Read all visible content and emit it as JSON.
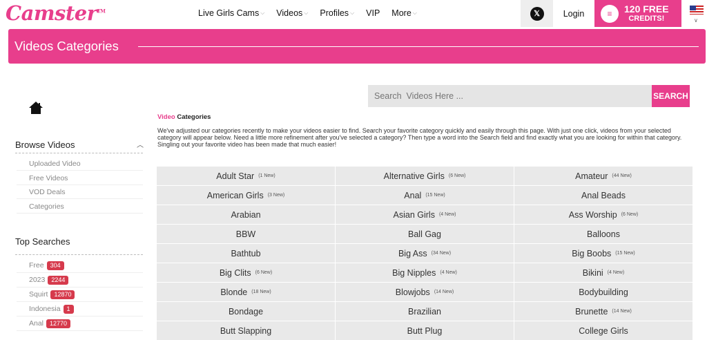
{
  "header": {
    "logo_text": "Camster",
    "logo_tm": "TM",
    "nav": [
      {
        "label": "Live Girls Cams",
        "caret": true
      },
      {
        "label": "Videos",
        "caret": true
      },
      {
        "label": "Profiles",
        "caret": true
      },
      {
        "label": "VIP",
        "caret": false
      },
      {
        "label": "More",
        "caret": true
      }
    ],
    "x_icon": "𝕏",
    "login": "Login",
    "credits_line1": "120 FREE",
    "credits_line2": "CREDITS!"
  },
  "banner": {
    "title": "Videos Categories"
  },
  "sidebar": {
    "browse_title": "Browse Videos",
    "browse_items": [
      "Uploaded Video",
      "Free Videos",
      "VOD Deals",
      "Categories"
    ],
    "top_title": "Top Searches",
    "top_searches": [
      {
        "term": "Free",
        "count": "304"
      },
      {
        "term": "2023",
        "count": "2244"
      },
      {
        "term": "Squirt",
        "count": "12870"
      },
      {
        "term": "Indonesia",
        "count": "1"
      },
      {
        "term": "Anal",
        "count": "12770"
      }
    ]
  },
  "search": {
    "placeholder": "Search  Videos Here ...",
    "button": "SEARCH"
  },
  "main": {
    "title_pink": "Video",
    "title_rest": "Categories",
    "intro": "We've adjusted our categories recently to make your videos easier to find. Search your favorite category quickly and easily through this page. With just one click, videos from your selected category will appear below. Need a little more refinement after you've selected a category? Then type a word into the Search field and find exactly what you are looking for within that category. Singling out your favorite video has been made that much easier!"
  },
  "categories": [
    {
      "name": "Adult Star",
      "new": "(1 New)"
    },
    {
      "name": "Alternative Girls",
      "new": "(6 New)"
    },
    {
      "name": "Amateur",
      "new": "(44 New)"
    },
    {
      "name": "American Girls",
      "new": "(3 New)"
    },
    {
      "name": "Anal",
      "new": "(15 New)"
    },
    {
      "name": "Anal Beads",
      "new": ""
    },
    {
      "name": "Arabian",
      "new": ""
    },
    {
      "name": "Asian Girls",
      "new": "(4 New)"
    },
    {
      "name": "Ass Worship",
      "new": "(6 New)"
    },
    {
      "name": "BBW",
      "new": ""
    },
    {
      "name": "Ball Gag",
      "new": ""
    },
    {
      "name": "Balloons",
      "new": ""
    },
    {
      "name": "Bathtub",
      "new": ""
    },
    {
      "name": "Big Ass",
      "new": "(34 New)"
    },
    {
      "name": "Big Boobs",
      "new": "(15 New)"
    },
    {
      "name": "Big Clits",
      "new": "(6 New)"
    },
    {
      "name": "Big Nipples",
      "new": "(4 New)"
    },
    {
      "name": "Bikini",
      "new": "(4 New)"
    },
    {
      "name": "Blonde",
      "new": "(18 New)"
    },
    {
      "name": "Blowjobs",
      "new": "(14 New)"
    },
    {
      "name": "Bodybuilding",
      "new": ""
    },
    {
      "name": "Bondage",
      "new": ""
    },
    {
      "name": "Brazilian",
      "new": ""
    },
    {
      "name": "Brunette",
      "new": "(14 New)"
    },
    {
      "name": "Butt Slapping",
      "new": ""
    },
    {
      "name": "Butt Plug",
      "new": ""
    },
    {
      "name": "College Girls",
      "new": ""
    }
  ]
}
